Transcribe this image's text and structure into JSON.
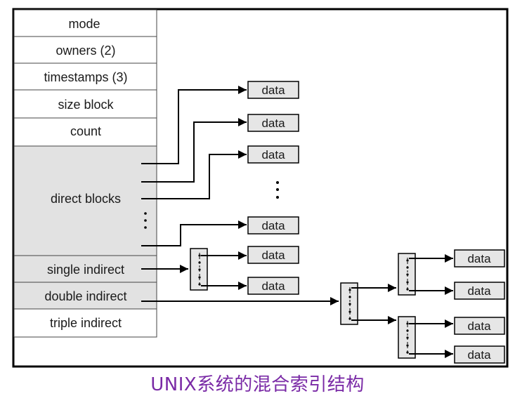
{
  "inode": {
    "fields": [
      {
        "id": "mode",
        "label": "mode"
      },
      {
        "id": "owners",
        "label": "owners (2)"
      },
      {
        "id": "timestamps",
        "label": "timestamps (3)"
      },
      {
        "id": "size-block",
        "label": "size block"
      },
      {
        "id": "count",
        "label": "count"
      },
      {
        "id": "direct-blocks",
        "label": "direct blocks"
      },
      {
        "id": "single-indirect",
        "label": "single indirect"
      },
      {
        "id": "double-indirect",
        "label": "double indirect"
      },
      {
        "id": "triple-indirect",
        "label": "triple indirect"
      }
    ]
  },
  "data_label": "data",
  "caption": "UNIX系统的混合索引结构",
  "colors": {
    "shaded": "#e2e2e2",
    "box": "#e6e6e6",
    "line": "#000000",
    "caption": "#7a2aa6"
  }
}
